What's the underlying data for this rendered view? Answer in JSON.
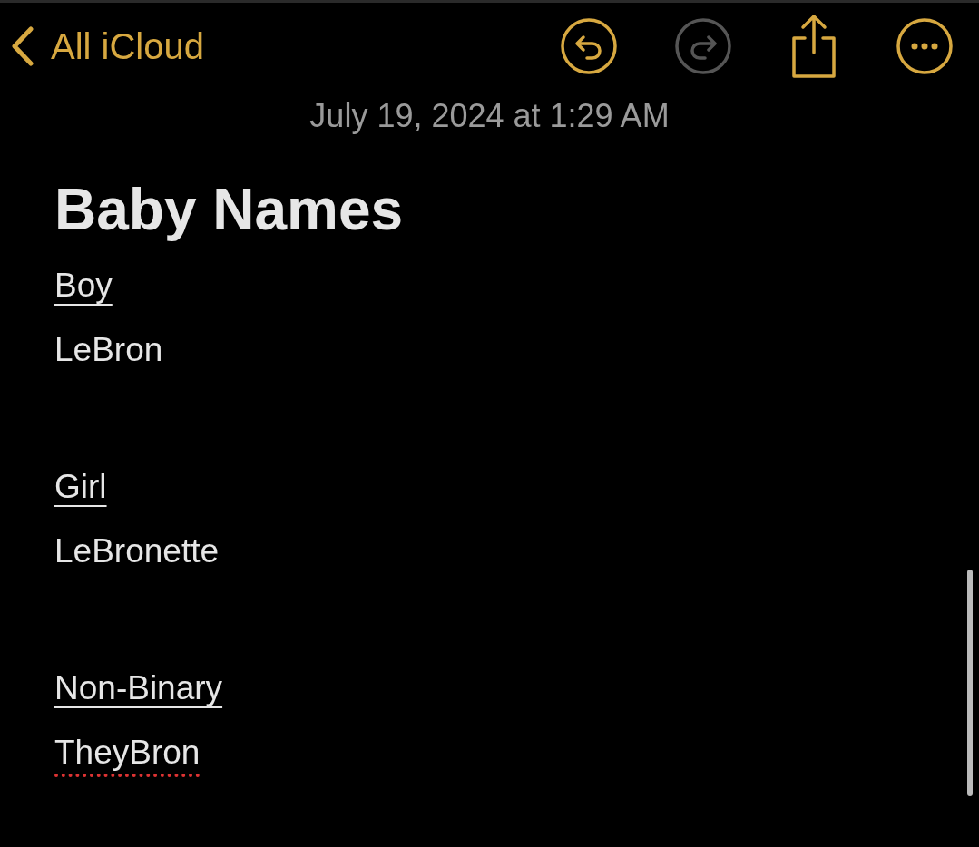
{
  "toolbar": {
    "back_label": "All iCloud",
    "undo": {
      "disabled": false
    },
    "redo": {
      "disabled": true
    }
  },
  "note": {
    "date": "July 19, 2024 at 1:29 AM",
    "title": "Baby Names",
    "sections": [
      {
        "heading": "Boy",
        "name": "LeBron",
        "misspelled": false
      },
      {
        "heading": "Girl",
        "name": "LeBronette",
        "misspelled": false
      },
      {
        "heading": "Non-Binary",
        "name": "TheyBron",
        "misspelled": true
      }
    ]
  }
}
